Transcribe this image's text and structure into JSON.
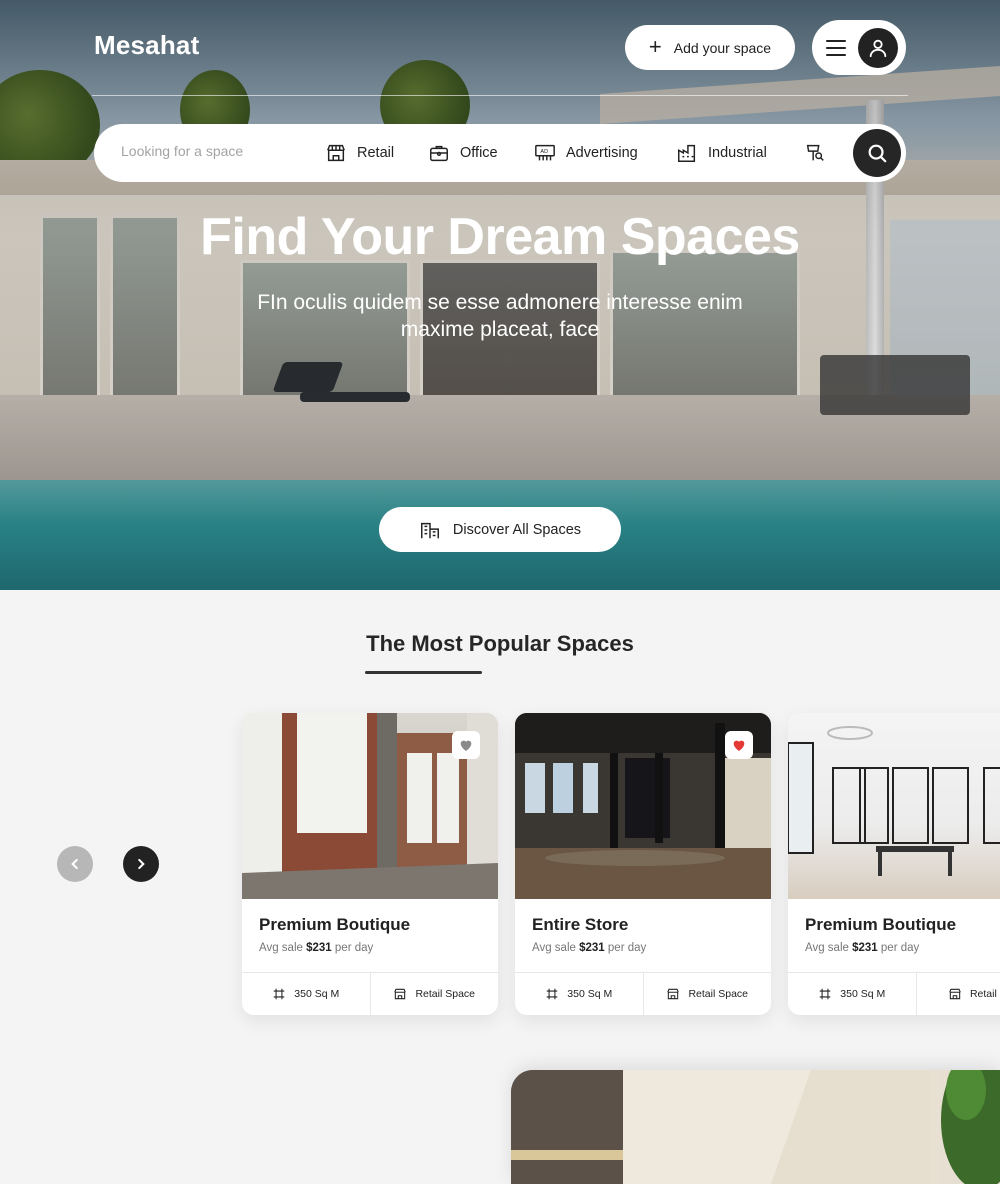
{
  "header": {
    "logo": "Mesahat",
    "add_space_label": "Add your space"
  },
  "search": {
    "placeholder": "Looking for a space",
    "categories": [
      {
        "label": "Retail",
        "icon": "storefront-icon"
      },
      {
        "label": "Office",
        "icon": "briefcase-icon"
      },
      {
        "label": "Advertising",
        "icon": "billboard-icon"
      },
      {
        "label": "Industrial",
        "icon": "factory-icon"
      },
      {
        "label": "",
        "icon": "location-sign-icon"
      }
    ]
  },
  "hero": {
    "title": "Find Your Dream Spaces",
    "subtitle": "FIn oculis quidem se esse admonere interesse enim maxime placeat, face",
    "discover_label": "Discover All Spaces"
  },
  "popular": {
    "title": "The Most Popular Spaces",
    "cards": [
      {
        "name": "Premium Boutique",
        "price_prefix": "Avg sale ",
        "price": "$231",
        "price_suffix": " per day",
        "area": "350 Sq M",
        "type": "Retail Space",
        "favorited": false
      },
      {
        "name": "Entire Store",
        "price_prefix": "Avg sale ",
        "price": "$231",
        "price_suffix": " per day",
        "area": "350 Sq M",
        "type": "Retail Space",
        "favorited": true
      },
      {
        "name": "Premium Boutique",
        "price_prefix": "Avg sale ",
        "price": "$231",
        "price_suffix": " per day",
        "area": "350 Sq M",
        "type": "Retail Sp",
        "favorited": false
      }
    ]
  },
  "colors": {
    "primary_dark": "#262626",
    "favorite_red": "#e53935",
    "favorite_grey": "#8a8a8a",
    "nav_disabled": "#b7b7b7"
  }
}
